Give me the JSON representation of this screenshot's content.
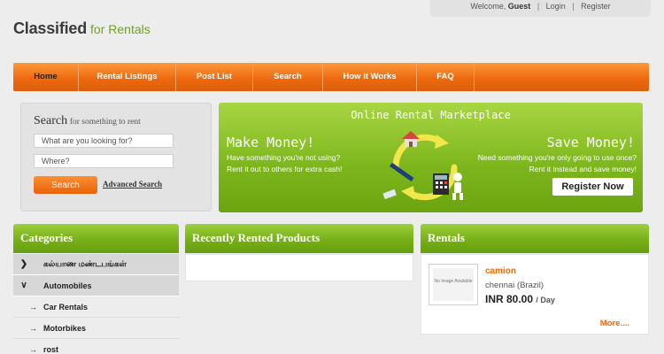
{
  "topbar": {
    "welcome": "Welcome,",
    "user": "Guest",
    "login": "Login",
    "register": "Register"
  },
  "logo": {
    "main": "Classified",
    "sub": "for Rentals"
  },
  "nav": {
    "items": [
      {
        "label": "Home"
      },
      {
        "label": "Rental Listings"
      },
      {
        "label": "Post List"
      },
      {
        "label": "Search"
      },
      {
        "label": "How It Works"
      },
      {
        "label": "FAQ"
      }
    ]
  },
  "search": {
    "title": "Search",
    "subtitle": "for something to rent",
    "what_placeholder": "What are you looking for?",
    "where_placeholder": "Where?",
    "button": "Search",
    "advanced": "Advanced Search"
  },
  "banner": {
    "title": "Online Rental Marketplace",
    "left_heading": "Make Money!",
    "left_line1": "Have something you're not using?",
    "left_line2": "Rent it out to others for extra cash!",
    "right_heading": "Save Money!",
    "right_line1": "Need something you're only going to use once?",
    "right_line2": "Rent it instead and save money!",
    "register_button": "Register Now"
  },
  "categories": {
    "heading": "Categories",
    "items": [
      {
        "label": "கல்யாண மண்டபங்கள்",
        "icon": "chevron-right-icon"
      },
      {
        "label": "Automobiles",
        "icon": "chevron-down-icon"
      }
    ],
    "subitems": [
      {
        "label": "Car Rentals"
      },
      {
        "label": "Motorbikes"
      },
      {
        "label": "rost"
      }
    ]
  },
  "recent": {
    "heading": "Recently Rented Products"
  },
  "rentals": {
    "heading": "Rentals",
    "item": {
      "image_text": "No Image Available",
      "name": "camion",
      "location": "chennai (Brazil)",
      "price": "INR 80.00",
      "period": "/ Day"
    },
    "more": "More...."
  },
  "colors": {
    "orange": "#ed6a0f",
    "green": "#7cb51b",
    "link_orange": "#ee6a0c"
  }
}
